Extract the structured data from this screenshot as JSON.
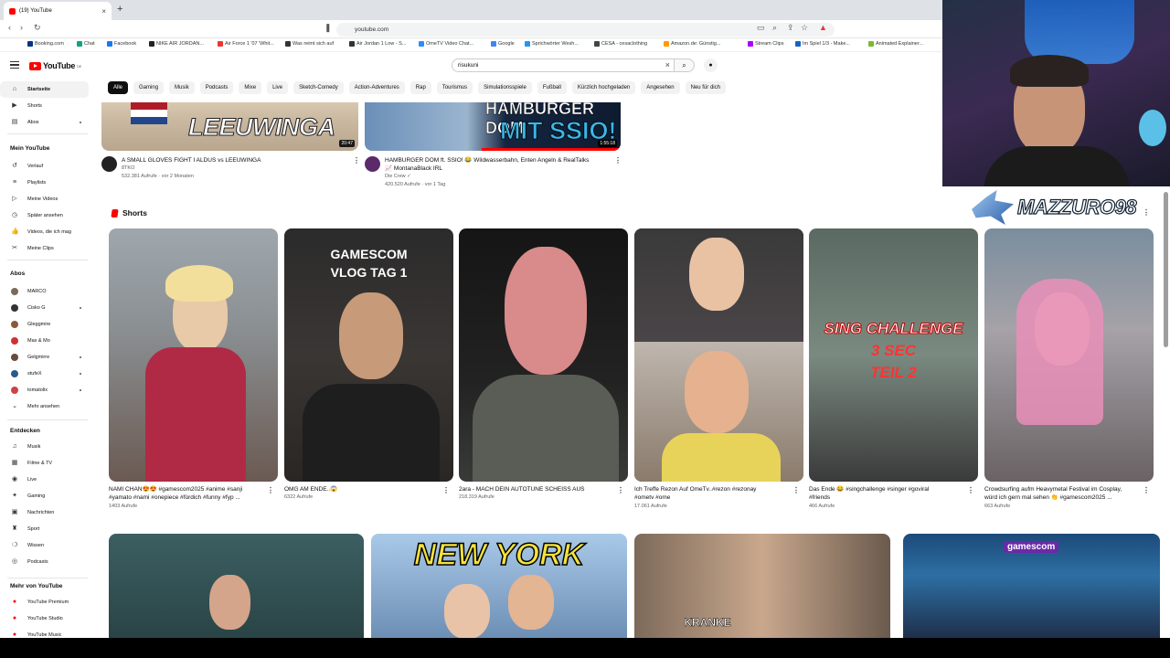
{
  "browser": {
    "tab_title": "(19) YouTube",
    "new_tab": "+",
    "url": "youtube.com",
    "bookmarks": [
      "Booking.com",
      "Chat",
      "Facebook",
      "NIKE AIR JORDAN...",
      "Air Force 1 '07 'Whit...",
      "Was reimt sich auf",
      "Air Jordan 1 Low - S...",
      "OmeTV Video Chat...",
      "Google",
      "Sprichwörter Wesh...",
      "CESA - cesaclothing",
      "Amazon.de: Günstig...",
      "Stream Clips",
      "Im Spiel 1/3 - Make...",
      "Animated Explainer..."
    ]
  },
  "youtube": {
    "logo": "YouTube",
    "region": "DE",
    "search_value": "risukuni",
    "chips": [
      "Alle",
      "Gaming",
      "Musik",
      "Podcasts",
      "Mixe",
      "Live",
      "Sketch-Comedy",
      "Action-Adventures",
      "Rap",
      "Tourismus",
      "Simulationsspiele",
      "Fußball",
      "Kürzlich hochgeladen",
      "Angesehen",
      "Neu für dich"
    ]
  },
  "sidebar": {
    "main": [
      "Startseite",
      "Shorts",
      "Abos"
    ],
    "you_title": "Mein YouTube",
    "you_items": [
      "Verlauf",
      "Playlists",
      "Meine Videos",
      "Später ansehen",
      "Videos, die ich mag",
      "Meine Clips"
    ],
    "subs_title": "Abos",
    "subs": [
      "MARCO",
      "Cisko G",
      "Gleggmire",
      "Max & Mo",
      "Gelgmirre",
      "stufeX",
      "tomatolix"
    ],
    "more": "Mehr ansehen",
    "explore_title": "Entdecken",
    "explore": [
      "Musik",
      "Filme & TV",
      "Live",
      "Gaming",
      "Nachrichten",
      "Sport",
      "Wissen",
      "Podcasts"
    ],
    "more_from_title": "Mehr von YouTube",
    "more_from": [
      "YouTube Premium",
      "YouTube Studio",
      "YouTube Music"
    ]
  },
  "videos": [
    {
      "title": "A SMALL GLOVES FIGHT I ALDUS vs LEEUWINGA",
      "channel": "8TKO",
      "meta": "532.381 Aufrufe · vor 2 Monaten",
      "duration": "20:47",
      "thumb_text": "LEEUWINGA",
      "thumb_vs": "vs"
    },
    {
      "title": "HAMBURGER DOM ft. SSIO! 😂 Wildwasserbahn, Enten Angeln & RealTalks",
      "title2": "📈 MontanaBlack IRL",
      "channel": "Die Crew ✓",
      "meta": "420.520 Aufrufe · vor 1 Tag",
      "duration": "1:55:18",
      "thumb_l1": "HAMBURGER DOM",
      "thumb_l2": "MIT SSIO!"
    }
  ],
  "shorts_title": "Shorts",
  "shorts": [
    {
      "title1": "NAMI CHAN😍😍 #gamescom2025 #anime #sanji",
      "title2": "#yamato #nami #onepiece #fürdich #funny #fyp ...",
      "views": "1403 Aufrufe"
    },
    {
      "title1": "OMG AM ENDE..😱",
      "title2": "",
      "views": "6322 Aufrufe",
      "overlay": "GAMESCOM VLOG TAG 1"
    },
    {
      "title1": "2ara - MACH DEIN AUTOTUNE SCHEISS AUS",
      "title2": "",
      "views": "218.319 Aufrufe"
    },
    {
      "title1": "Ich Treffe Rezon Auf OmeTv..#rezon #rezonay",
      "title2": "#ometv #ome",
      "views": "17.061 Aufrufe"
    },
    {
      "title1": "Das Ende 😂 #singchallenge #singer #goviral",
      "title2": "#friends",
      "views": "466 Aufrufe",
      "overlay1": "SING CHALLENGE",
      "overlay2": "3 SEC",
      "overlay3": "TEIL 2"
    },
    {
      "title1": "Crowdsurfing aufm Heavymetal Festival im Cosplay,",
      "title2": "würd ich gern mal sehen 👏 #gamescom2025 ...",
      "views": "663 Aufrufe"
    }
  ],
  "bottom_row": {
    "t2": "NEW YORK",
    "t3": "KRANKE",
    "t4": "gamescom"
  },
  "overlay_badge": "MAZZURO98",
  "colors": {
    "accent": "#ff0000",
    "chip_active": "#0f0f0f"
  }
}
